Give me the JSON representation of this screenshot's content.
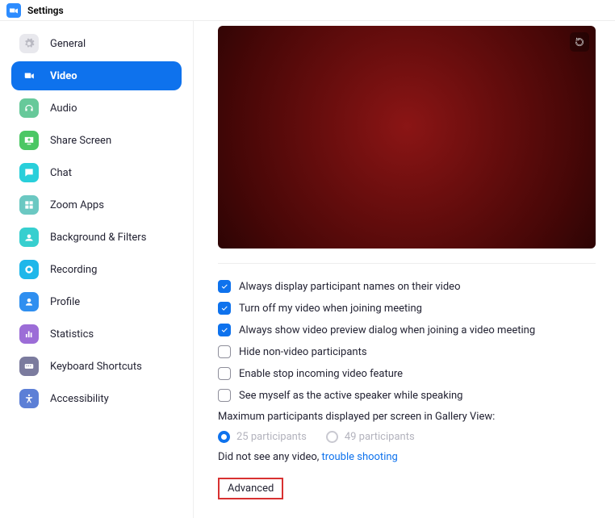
{
  "window": {
    "title": "Settings"
  },
  "sidebar": {
    "items": [
      {
        "label": "General",
        "color": "#e8e8ed"
      },
      {
        "label": "Video",
        "color": "transparent",
        "active": true
      },
      {
        "label": "Audio",
        "color": "#67c99a"
      },
      {
        "label": "Share Screen",
        "color": "#4bc764"
      },
      {
        "label": "Chat",
        "color": "#29cfda"
      },
      {
        "label": "Zoom Apps",
        "color": "#6bc8c2"
      },
      {
        "label": "Background & Filters",
        "color": "#37cfcf"
      },
      {
        "label": "Recording",
        "color": "#1fb7ea"
      },
      {
        "label": "Profile",
        "color": "#2f8ff0"
      },
      {
        "label": "Statistics",
        "color": "#9c6dd7"
      },
      {
        "label": "Keyboard Shortcuts",
        "color": "#7b7b9e"
      },
      {
        "label": "Accessibility",
        "color": "#5c7fd6"
      }
    ]
  },
  "options": {
    "opt1": {
      "label": "Always display participant names on their video",
      "checked": true
    },
    "opt2": {
      "label": "Turn off my video when joining meeting",
      "checked": true
    },
    "opt3": {
      "label": "Always show video preview dialog when joining a video meeting",
      "checked": true
    },
    "opt4": {
      "label": "Hide non-video participants",
      "checked": false
    },
    "opt5": {
      "label": "Enable stop incoming video feature",
      "checked": false
    },
    "opt6": {
      "label": "See myself as the active speaker while speaking",
      "checked": false
    }
  },
  "gallery": {
    "title": "Maximum participants displayed per screen in Gallery View:",
    "r1": "25 participants",
    "r2": "49 participants",
    "selected": 0
  },
  "help": {
    "prefix": "Did not see any video, ",
    "link": "trouble shooting"
  },
  "advanced_label": "Advanced"
}
